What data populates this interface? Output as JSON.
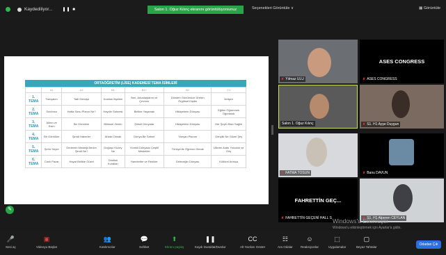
{
  "topbar": {
    "recording_label": "Kaydediliyor...",
    "pause_label": "❚❚ ■",
    "share_banner": "Salon 1. Oğuz Kılınç ekranını görüntülüyorsunuz",
    "view_options": "Seçenekleri Görüntüle  ∨",
    "view_button": "Görüntüle"
  },
  "slide": {
    "title": "ORTAÖĞRETİM (LİSE) KADEMESİ TEMA İSİMLERİ",
    "headers": [
      "",
      "A1",
      "A2",
      "B1",
      "B1+",
      "B2",
      "C1"
    ],
    "rows": [
      {
        "tema": "1. TEMA",
        "cells": [
          "Tanışalım",
          "Tatil Dönüşü",
          "Dostluk İlişkileri",
          "Ben, Arkadaşlarım ve Çevrem",
          "Dünden Günümüze Üreten Örgütsel Kişiler",
          "İletişim"
        ]
      },
      {
        "tema": "2. TEMA",
        "cells": [
          "Sınıfımız",
          "Hafta Sonu Planın Ne?",
          "Haydin Sahnesi",
          "Birlikte Yaşamak",
          "Hikâyelerin Dünyası",
          "Eğitim Öğrenmek Öğretmek"
        ]
      },
      {
        "tema": "3. TEMA",
        "cells": [
          "Ailem ve Evim",
          "Bir Gönülüm",
          "Bilimsel Zemin",
          "Şiirsel Dünyalar",
          "Hikâyelerin Dünyası",
          "Her Şeyin Bazı Sağlık"
        ]
      },
      {
        "tema": "4. TEMA",
        "cells": [
          "Bir Gönülüm",
          "Şimdi Haberler",
          "Ahlaki Olmak",
          "Dünya Bir Sahne",
          "Yarışan Planım",
          "Gençlik Ne Güzel Şey"
        ]
      },
      {
        "tema": "5. TEMA",
        "cells": [
          "Şehir Seyre",
          "Dedemin Mesleği Benim Şimdi Ne?",
          "Doğuşu Kuzey Ne",
          "Yürekli Dünyalar Çeşitli Meslekler",
          "Türkiye'de Öğrenci Olmak",
          "Ülkeler Arası Yolculuk ve Göç"
        ]
      },
      {
        "tema": "6. TEMA",
        "cells": [
          "Canlı Pazar",
          "Hayat Birlikte Güzel",
          "Dostluk Kuralları",
          "Hareketler ve Renkler",
          "Geleceğin Dünyası",
          "Kültürel Armiça"
        ]
      }
    ]
  },
  "participants": [
    {
      "name": "Yılmaz ULU",
      "kind": "video"
    },
    {
      "name": "ASES CONGRESS",
      "kind": "name"
    },
    {
      "name": "Salon 1. Oğuz Kılınç",
      "kind": "video"
    },
    {
      "name": "S1. H1 Ayşe Duygun",
      "kind": "video"
    },
    {
      "name": "FATMA TOSUN",
      "kind": "video"
    },
    {
      "name": "Banu DAVUN",
      "kind": "video"
    },
    {
      "name": "FAHRETTİN GEÇ...",
      "display_name": "FAHRETTİN GEÇ...",
      "kind": "name"
    },
    {
      "name": "FAHRETTİN GEÇENİ HALL S",
      "kind": "label-only"
    },
    {
      "name": "S1. H1 Alperen CEYLAN",
      "kind": "video"
    }
  ],
  "watermark": {
    "line1": "Windows'u Etkinleştir",
    "line2": "Windows'u etkinleştirmek için Ayarlar'a gidin."
  },
  "toolbar": {
    "items": [
      {
        "icon": "🎤",
        "label": "Sesi aç"
      },
      {
        "icon": "▣",
        "label": "Videoyu Başlat"
      },
      {
        "icon": "👥",
        "label": "Katılımcılar"
      },
      {
        "icon": "💬",
        "label": "Sohbet"
      },
      {
        "icon": "⬆",
        "label": "Ekranı paylaş"
      },
      {
        "icon": "❚❚",
        "label": "Kaydı Duraklat/Durdur"
      },
      {
        "icon": "CC",
        "label": "Alt Yazıları Göster"
      },
      {
        "icon": "☷",
        "label": "Ara Odalar"
      },
      {
        "icon": "☺",
        "label": "Reaksiyonlar"
      },
      {
        "icon": "⬚",
        "label": "Uygulamalar"
      },
      {
        "icon": "▢",
        "label": "Beyaz Tahtalar"
      }
    ],
    "leave_label": "Odadan Çık"
  }
}
